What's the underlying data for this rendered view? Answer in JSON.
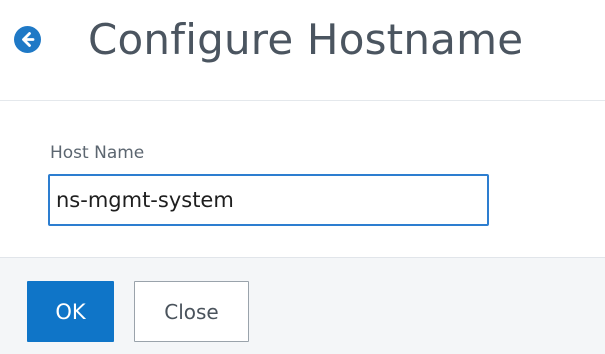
{
  "header": {
    "title": "Configure Hostname",
    "back_icon": "arrow-left-circle-icon"
  },
  "form": {
    "hostname_label": "Host Name",
    "hostname_value": "ns-mgmt-system"
  },
  "footer": {
    "ok_label": "OK",
    "close_label": "Close"
  },
  "colors": {
    "accent": "#0f75c8",
    "title": "#4b5560"
  }
}
